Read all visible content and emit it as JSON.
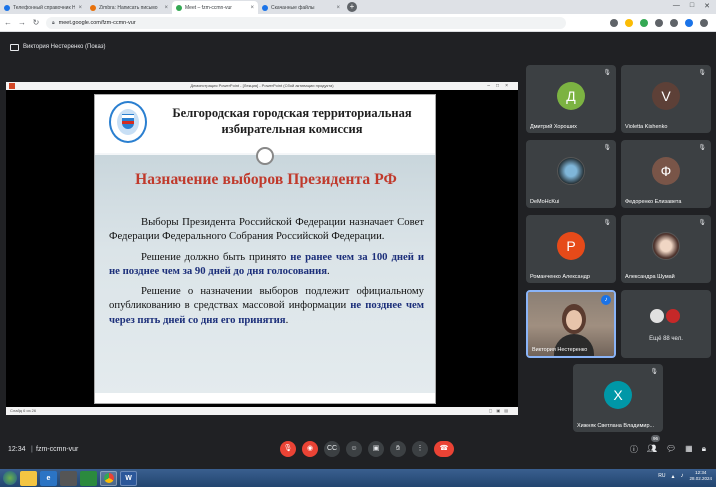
{
  "browser": {
    "tabs": [
      {
        "title": "Телефонный справочник НИУ",
        "color": "#1a73e8",
        "active": false
      },
      {
        "title": "Zimbra: Написать письмо",
        "color": "#e8710a",
        "active": false
      },
      {
        "title": "Meet – fzm-ccmn-vur",
        "color": "#34a853",
        "active": true
      },
      {
        "title": "Скачанные файлы",
        "color": "#1a73e8",
        "active": false
      }
    ],
    "url": "meet.google.com/fzm-ccmn-vur"
  },
  "meet": {
    "presenter_label": "Виктория Нестеренко (Показ)",
    "time": "12:34",
    "separator": "|",
    "meeting_code": "fzm-ccmn-vur",
    "people_count": "96"
  },
  "ppt": {
    "window_title": "Демонстрация PowerPoint - [Лекция] - PowerPoint (Сбой активации продукта)",
    "status": "Слайд 6 из 26"
  },
  "slide": {
    "org": "Белгородская городская территориальная избирательная комиссия",
    "title": "Назначение выборов Президента РФ",
    "p1": "Выборы Президента Российской Федерации назначает Совет Федерации Федерального Собрания Российской Федерации.",
    "p2_start": "Решение должно быть принято ",
    "p2_bold": "не ранее чем за 100 дней и не позднее чем за 90 дней до дня голосования",
    "p2_end": ".",
    "p3_start": "Решение о назначении выборов подлежит официальному опубликованию в средствах массовой информации ",
    "p3_bold": "не позднее чем через пять дней со дня его принятия",
    "p3_end": "."
  },
  "participants": [
    {
      "name": "Дмитрий Хороших",
      "initial": "Д",
      "color": "#7cb342"
    },
    {
      "name": "Violetta Kishenko",
      "initial": "V",
      "color": "#5d4037"
    },
    {
      "name": "DeMoHcKui",
      "initial": "",
      "color": "#263238"
    },
    {
      "name": "Федоренко Елизавета",
      "initial": "Ф",
      "color": "#795548"
    },
    {
      "name": "Романченко Александр",
      "initial": "Р",
      "color": "#e64a19"
    },
    {
      "name": "Александра Шумай",
      "initial": "",
      "color": "#4e342e"
    },
    {
      "name": "Виктория Нестеренко",
      "initial": "",
      "color": "#8b7f74"
    },
    {
      "name": "Ещё 88 чел.",
      "initial": "",
      "color": "#3c4043"
    },
    {
      "name": "Хижняк Светлана Владимир...",
      "initial": "Х",
      "color": "#0097a7"
    }
  ],
  "taskbar": {
    "lang": "RU",
    "clock_time": "12:34",
    "clock_date": "28.02.2024",
    "word_label": "W"
  },
  "icons": {
    "mic_off": "mic-off-icon",
    "present": "present-icon",
    "hangup": "hangup-icon"
  }
}
